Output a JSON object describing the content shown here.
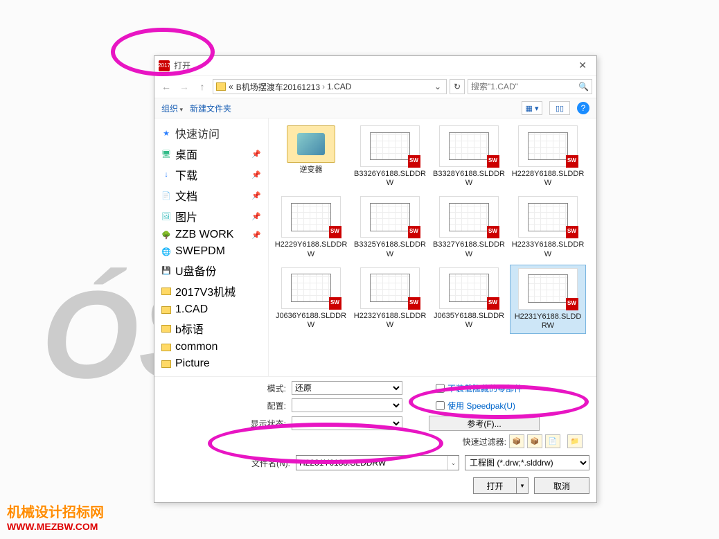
{
  "background": {
    "watermark_line1": "机械设计招标网",
    "watermark_line2": "WWW.MEZBW.COM"
  },
  "dialog": {
    "title": "打开",
    "breadcrumb": {
      "prefix": "«",
      "part1": "B机场摆渡车20161213",
      "part2": "1.CAD"
    },
    "search_placeholder": "搜索\"1.CAD\"",
    "toolbar": {
      "organize": "组织",
      "newfolder": "新建文件夹"
    },
    "sidebar": {
      "header": "快速访问",
      "items": [
        {
          "label": "桌面",
          "pinned": true,
          "icon": "desktop"
        },
        {
          "label": "下载",
          "pinned": true,
          "icon": "download"
        },
        {
          "label": "文档",
          "pinned": true,
          "icon": "doc"
        },
        {
          "label": "图片",
          "pinned": true,
          "icon": "pic"
        },
        {
          "label": "ZZB WORK",
          "pinned": true,
          "icon": "tree"
        },
        {
          "label": "SWEPDM",
          "pinned": false,
          "icon": "pdm"
        },
        {
          "label": "U盘备份",
          "pinned": false,
          "icon": "usb"
        },
        {
          "label": "2017V3机械",
          "pinned": false,
          "icon": "folder"
        },
        {
          "label": "1.CAD",
          "pinned": false,
          "icon": "folder"
        },
        {
          "label": "b标语",
          "pinned": false,
          "icon": "folder"
        },
        {
          "label": "common",
          "pinned": false,
          "icon": "folder"
        },
        {
          "label": "Picture",
          "pinned": false,
          "icon": "folder"
        }
      ]
    },
    "files": [
      {
        "name": "逆变器",
        "type": "folder"
      },
      {
        "name": "B3326Y6188.SLDDRW",
        "type": "drw"
      },
      {
        "name": "B3328Y6188.SLDDRW",
        "type": "drw"
      },
      {
        "name": "H2228Y6188.SLDDRW",
        "type": "drw"
      },
      {
        "name": "H2229Y6188.SLDDRW",
        "type": "drw"
      },
      {
        "name": "B3325Y6188.SLDDRW",
        "type": "drw"
      },
      {
        "name": "B3327Y6188.SLDDRW",
        "type": "drw"
      },
      {
        "name": "H2233Y6188.SLDDRW",
        "type": "drw"
      },
      {
        "name": "J0636Y6188.SLDDRW",
        "type": "drw"
      },
      {
        "name": "H2232Y6188.SLDDRW",
        "type": "drw"
      },
      {
        "name": "J0635Y6188.SLDDRW",
        "type": "drw"
      },
      {
        "name": "H2231Y6188.SLDDRW",
        "type": "drw",
        "selected": true
      }
    ],
    "options": {
      "mode_label": "模式:",
      "mode_value": "还原",
      "config_label": "配置:",
      "state_label": "显示状态:",
      "chk1": "不装载隐藏的零部件",
      "chk2": "使用 Speedpak(U)",
      "ref_button": "参考(F)...",
      "filter_label": "快速过滤器:"
    },
    "filename_label": "文件名(N):",
    "filename_value": "H2231Y6188.SLDDRW",
    "filetype_value": "工程图 (*.drw;*.slddrw)",
    "open_button": "打开",
    "cancel_button": "取消"
  }
}
